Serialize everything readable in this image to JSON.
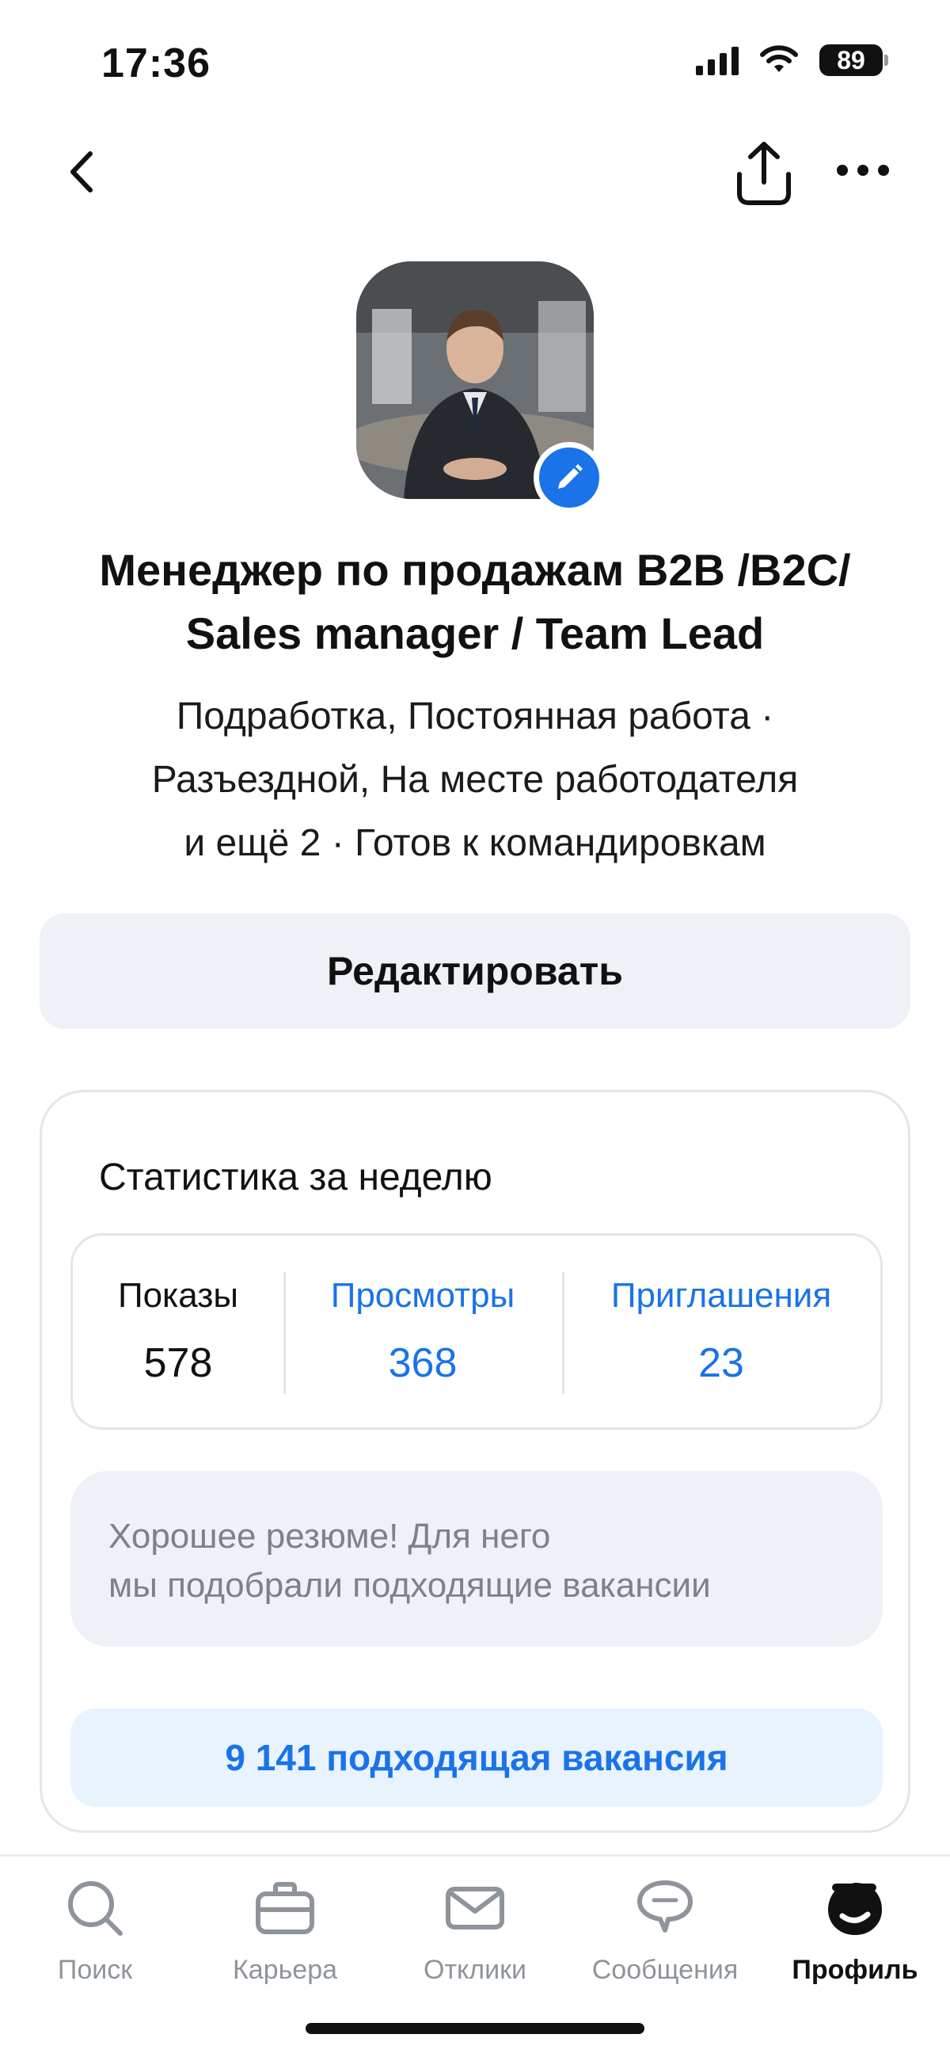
{
  "status_bar": {
    "time": "17:36",
    "battery": "89"
  },
  "nav": {
    "back_icon": "chevron-left-icon",
    "share_icon": "share-icon",
    "more_icon": "more-dots-icon"
  },
  "profile": {
    "avatar_icon": "avatar-photo",
    "edit_avatar_icon": "pencil-icon",
    "title": "Менеджер по продажам B2B /B2C/ Sales manager / Team Lead",
    "subtitle_lines": [
      "Подработка, Постоянная работа ·",
      "Разъездной, На месте работодателя",
      "и ещё 2 · Готов к командировкам"
    ],
    "edit_button": "Редактировать"
  },
  "stats": {
    "title": "Статистика за неделю",
    "items": [
      {
        "label": "Показы",
        "value": "578"
      },
      {
        "label": "Просмотры",
        "value": "368"
      },
      {
        "label": "Приглашения",
        "value": "23"
      }
    ],
    "advice_lines": [
      "Хорошее резюме! Для него",
      "мы подобрали подходящие вакансии"
    ],
    "vacancies_button": "9 141 подходящая вакансия"
  },
  "colors": {
    "accent": "#1a73e8",
    "light_accent_bg": "#e8f3fe",
    "muted_bg": "#eef1f6",
    "border": "#e3e6ea",
    "inactive_tab": "#8e949a"
  },
  "tab_bar": {
    "tabs": [
      {
        "label": "Поиск",
        "icon": "search-icon"
      },
      {
        "label": "Карьера",
        "icon": "briefcase-icon"
      },
      {
        "label": "Отклики",
        "icon": "envelope-icon"
      },
      {
        "label": "Сообщения",
        "icon": "chat-bubble-icon"
      },
      {
        "label": "Профиль",
        "icon": "profile-logo-icon"
      }
    ],
    "active": "Профиль"
  }
}
